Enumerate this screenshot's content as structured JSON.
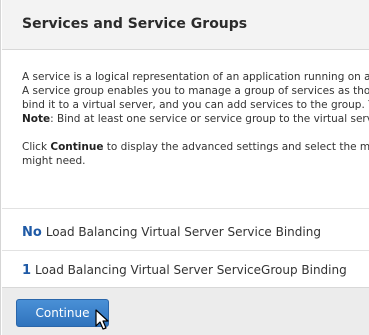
{
  "header": {
    "title": "Services and Service Groups"
  },
  "description": {
    "line1": "A service is a logical representation of an application running on a",
    "line2": "A service group enables you to manage a group of services as tho",
    "line3": "bind it to a virtual server, and you can add services to the group. Y",
    "note_label": "Note",
    "note_text": ": Bind at least one service or service group to the virtual serve",
    "click_prefix": "Click ",
    "click_bold": "Continue",
    "click_suffix": " to display the advanced settings and select the me",
    "line_last": "might need."
  },
  "bindings": [
    {
      "count": "No",
      "label": "Load Balancing Virtual Server Service Binding"
    },
    {
      "count": "1",
      "label": "Load Balancing Virtual Server ServiceGroup Binding"
    }
  ],
  "footer": {
    "continue_label": "Continue"
  }
}
